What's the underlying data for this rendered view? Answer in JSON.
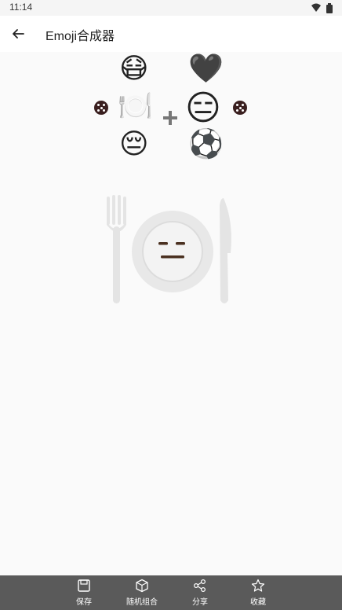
{
  "status_bar": {
    "time": "11:14"
  },
  "app_bar": {
    "title": "Emoji合成器"
  },
  "emoji_picker": {
    "top_row": [
      "😷",
      "🖤"
    ],
    "middle_row": [
      "🍽️",
      "😑"
    ],
    "bottom_row": [
      "😔",
      "⚽"
    ],
    "plus_label": "+"
  },
  "result": {
    "emoji_icon": "plate-with-expressionless-face-icon"
  },
  "bottom_tabs": [
    {
      "label": "保存",
      "icon": "save-icon"
    },
    {
      "label": "随机组合",
      "icon": "cube-icon"
    },
    {
      "label": "分享",
      "icon": "share-icon"
    },
    {
      "label": "收藏",
      "icon": "star-icon"
    }
  ]
}
